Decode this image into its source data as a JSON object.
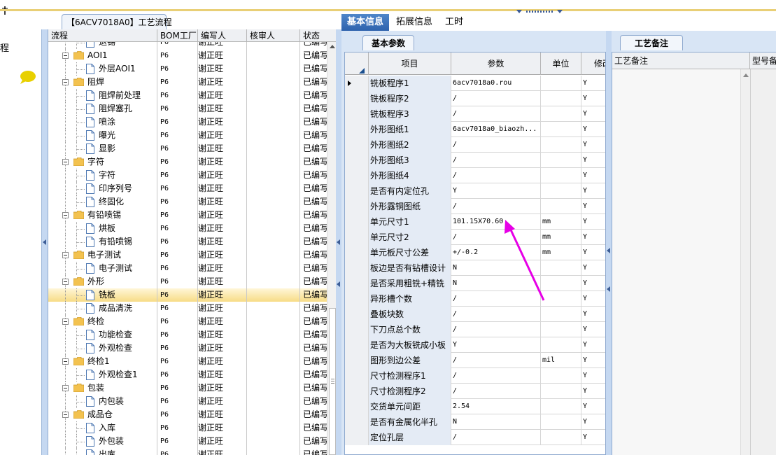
{
  "colors": {
    "accent": "#2d62ad",
    "selected_row": "#f7dc86",
    "annotation_arrow": "#e600e6"
  },
  "left_pane": {
    "label": "程"
  },
  "tree": {
    "tab_title": "【6ACV7018A0】工艺流程",
    "columns": [
      "流程",
      "BOM工厂",
      "编写人",
      "核审人",
      "状态"
    ],
    "rows": [
      {
        "name": "退锡",
        "level": 2,
        "kind": "doc",
        "bom": "P6",
        "writer": "谢正旺",
        "status": "已编写"
      },
      {
        "name": "AOI1",
        "level": 1,
        "kind": "folder",
        "bom": "P6",
        "writer": "谢正旺",
        "status": "已编写"
      },
      {
        "name": "外层AOI1",
        "level": 2,
        "kind": "doc",
        "bom": "P6",
        "writer": "谢正旺",
        "status": "已编写"
      },
      {
        "name": "阻焊",
        "level": 1,
        "kind": "folder",
        "bom": "P6",
        "writer": "谢正旺",
        "status": "已编写"
      },
      {
        "name": "阻焊前处理",
        "level": 2,
        "kind": "doc",
        "bom": "P6",
        "writer": "谢正旺",
        "status": "已编写"
      },
      {
        "name": "阻焊塞孔",
        "level": 2,
        "kind": "doc",
        "bom": "P6",
        "writer": "谢正旺",
        "status": "已编写"
      },
      {
        "name": "喷涂",
        "level": 2,
        "kind": "doc",
        "bom": "P6",
        "writer": "谢正旺",
        "status": "已编写"
      },
      {
        "name": "曝光",
        "level": 2,
        "kind": "doc",
        "bom": "P6",
        "writer": "谢正旺",
        "status": "已编写"
      },
      {
        "name": "显影",
        "level": 2,
        "kind": "doc",
        "bom": "P6",
        "writer": "谢正旺",
        "status": "已编写"
      },
      {
        "name": "字符",
        "level": 1,
        "kind": "folder",
        "bom": "P6",
        "writer": "谢正旺",
        "status": "已编写"
      },
      {
        "name": "字符",
        "level": 2,
        "kind": "doc",
        "bom": "P6",
        "writer": "谢正旺",
        "status": "已编写"
      },
      {
        "name": "印序列号",
        "level": 2,
        "kind": "doc",
        "bom": "P6",
        "writer": "谢正旺",
        "status": "已编写"
      },
      {
        "name": "终固化",
        "level": 2,
        "kind": "doc",
        "bom": "P6",
        "writer": "谢正旺",
        "status": "已编写"
      },
      {
        "name": "有铅喷锡",
        "level": 1,
        "kind": "folder",
        "bom": "P6",
        "writer": "谢正旺",
        "status": "已编写"
      },
      {
        "name": "烘板",
        "level": 2,
        "kind": "doc",
        "bom": "P6",
        "writer": "谢正旺",
        "status": "已编写"
      },
      {
        "name": "有铅喷锡",
        "level": 2,
        "kind": "doc",
        "bom": "P6",
        "writer": "谢正旺",
        "status": "已编写"
      },
      {
        "name": "电子测试",
        "level": 1,
        "kind": "folder",
        "bom": "P6",
        "writer": "谢正旺",
        "status": "已编写"
      },
      {
        "name": "电子测试",
        "level": 2,
        "kind": "doc",
        "bom": "P6",
        "writer": "谢正旺",
        "status": "已编写"
      },
      {
        "name": "外形",
        "level": 1,
        "kind": "folder",
        "bom": "P6",
        "writer": "谢正旺",
        "status": "已编写"
      },
      {
        "name": "铣板",
        "level": 2,
        "kind": "doc",
        "bom": "P6",
        "writer": "谢正旺",
        "status": "已编写",
        "selected": true
      },
      {
        "name": "成品清洗",
        "level": 2,
        "kind": "doc",
        "bom": "P6",
        "writer": "谢正旺",
        "status": "已编写"
      },
      {
        "name": "终检",
        "level": 1,
        "kind": "folder",
        "bom": "P6",
        "writer": "谢正旺",
        "status": "已编写"
      },
      {
        "name": "功能检查",
        "level": 2,
        "kind": "doc",
        "bom": "P6",
        "writer": "谢正旺",
        "status": "已编写"
      },
      {
        "name": "外观检查",
        "level": 2,
        "kind": "doc",
        "bom": "P6",
        "writer": "谢正旺",
        "status": "已编写"
      },
      {
        "name": "终检1",
        "level": 1,
        "kind": "folder",
        "bom": "P6",
        "writer": "谢正旺",
        "status": "已编写"
      },
      {
        "name": "外观检查1",
        "level": 2,
        "kind": "doc",
        "bom": "P6",
        "writer": "谢正旺",
        "status": "已编写"
      },
      {
        "name": "包装",
        "level": 1,
        "kind": "folder",
        "bom": "P6",
        "writer": "谢正旺",
        "status": "已编写"
      },
      {
        "name": "内包装",
        "level": 2,
        "kind": "doc",
        "bom": "P6",
        "writer": "谢正旺",
        "status": "已编写"
      },
      {
        "name": "成品仓",
        "level": 1,
        "kind": "folder",
        "bom": "P6",
        "writer": "谢正旺",
        "status": "已编写"
      },
      {
        "name": "入库",
        "level": 2,
        "kind": "doc",
        "bom": "P6",
        "writer": "谢正旺",
        "status": "已编写"
      },
      {
        "name": "外包装",
        "level": 2,
        "kind": "doc",
        "bom": "P6",
        "writer": "谢正旺",
        "status": "已编写"
      },
      {
        "name": "出库",
        "level": 2,
        "kind": "doc",
        "bom": "P6",
        "writer": "谢正旺",
        "status": "已编写"
      }
    ]
  },
  "main_tabs": [
    "基本信息",
    "拓展信息",
    "工时"
  ],
  "params": {
    "subtab": "基本参数",
    "columns": [
      "项目",
      "参数",
      "单位",
      "修改"
    ],
    "rows": [
      {
        "item": "铣板程序1",
        "value": "6acv7018a0.rou",
        "unit": "",
        "mod": "Y",
        "current": true
      },
      {
        "item": "铣板程序2",
        "value": "/",
        "unit": "",
        "mod": "Y"
      },
      {
        "item": "铣板程序3",
        "value": "/",
        "unit": "",
        "mod": "Y"
      },
      {
        "item": "外形图纸1",
        "value": "6acv7018a0_biaozh...",
        "unit": "",
        "mod": "Y"
      },
      {
        "item": "外形图纸2",
        "value": "/",
        "unit": "",
        "mod": "Y"
      },
      {
        "item": "外形图纸3",
        "value": "/",
        "unit": "",
        "mod": "Y"
      },
      {
        "item": "外形图纸4",
        "value": "/",
        "unit": "",
        "mod": "Y"
      },
      {
        "item": "是否有内定位孔",
        "value": "Y",
        "unit": "",
        "mod": "Y"
      },
      {
        "item": "外形露铜图纸",
        "value": "/",
        "unit": "",
        "mod": "Y"
      },
      {
        "item": "单元尺寸1",
        "value": "101.15X70.60",
        "unit": "mm",
        "mod": "Y"
      },
      {
        "item": "单元尺寸2",
        "value": "/",
        "unit": "mm",
        "mod": "Y"
      },
      {
        "item": "单元板尺寸公差",
        "value": "+/-0.2",
        "unit": "mm",
        "mod": "Y"
      },
      {
        "item": "板边是否有钻槽设计",
        "value": "N",
        "unit": "",
        "mod": "Y"
      },
      {
        "item": "是否采用粗铣+精铣",
        "value": "N",
        "unit": "",
        "mod": "Y"
      },
      {
        "item": "异形槽个数",
        "value": "/",
        "unit": "",
        "mod": "Y"
      },
      {
        "item": "叠板块数",
        "value": "/",
        "unit": "",
        "mod": "Y"
      },
      {
        "item": "下刀点总个数",
        "value": "/",
        "unit": "",
        "mod": "Y"
      },
      {
        "item": "是否为大板铣成小板",
        "value": "Y",
        "unit": "",
        "mod": "Y"
      },
      {
        "item": "图形到边公差",
        "value": "/",
        "unit": "mil",
        "mod": "Y"
      },
      {
        "item": "尺寸检测程序1",
        "value": "/",
        "unit": "",
        "mod": "Y"
      },
      {
        "item": "尺寸检测程序2",
        "value": "/",
        "unit": "",
        "mod": "Y"
      },
      {
        "item": "交货单元间距",
        "value": "2.54",
        "unit": "",
        "mod": "Y"
      },
      {
        "item": "是否有金属化半孔",
        "value": "N",
        "unit": "",
        "mod": "Y"
      },
      {
        "item": "定位孔层",
        "value": "/",
        "unit": "",
        "mod": "Y"
      }
    ]
  },
  "notes": {
    "subtab": "工艺备注",
    "columns": [
      "工艺备注",
      "型号备注"
    ]
  }
}
